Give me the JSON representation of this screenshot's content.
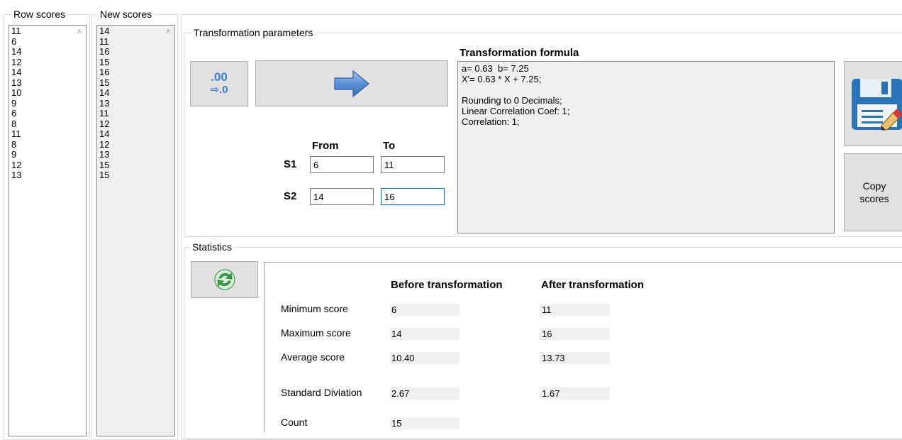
{
  "row_scores": {
    "title": "Row scores",
    "items": [
      "11",
      "6",
      "14",
      "12",
      "14",
      "13",
      "10",
      "9",
      "6",
      "8",
      "11",
      "8",
      "9",
      "12",
      "13"
    ]
  },
  "new_scores": {
    "title": "New scores",
    "items": [
      "14",
      "11",
      "16",
      "15",
      "16",
      "15",
      "14",
      "13",
      "11",
      "12",
      "14",
      "12",
      "13",
      "15",
      "15"
    ]
  },
  "transformation": {
    "title": "Transformation parameters",
    "rounding_button": ".00\n⇨.0",
    "from_header": "From",
    "to_header": "To",
    "s1_label": "S1",
    "s2_label": "S2",
    "s1_from": "6",
    "s1_to": "11",
    "s2_from": "14",
    "s2_to": "16",
    "formula_title": "Transformation formula",
    "formula_text": "a= 0.63  b= 7.25\nX'= 0.63 * X + 7.25;\n\nRounding to 0 Decimals;\nLinear Correlation Coef: 1;\nCorrelation: 1;",
    "copy_button": "Copy\nscores"
  },
  "statistics": {
    "title": "Statistics",
    "before_header": "Before transformation",
    "after_header": "After transformation",
    "rows": [
      {
        "label": "Minimum score",
        "before": "6",
        "after": "11"
      },
      {
        "label": "Maximum score",
        "before": "14",
        "after": "16"
      },
      {
        "label": "Average score",
        "before": "10.40",
        "after": "13.73"
      },
      {
        "label": "Standard Diviation",
        "before": "2.67",
        "after": "1.67"
      },
      {
        "label": "Count",
        "before": "15",
        "after": ""
      }
    ]
  },
  "colors": {
    "arrow": "#5b8fd6",
    "save_icon": "#2b73b9",
    "refresh": "#3aa64a"
  }
}
